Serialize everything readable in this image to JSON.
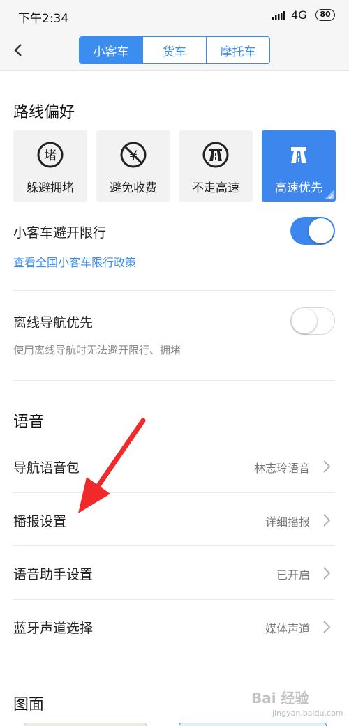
{
  "status": {
    "time": "下午2:34",
    "network": "4G",
    "battery": "80"
  },
  "header": {
    "tabs": [
      {
        "label": "小客车"
      },
      {
        "label": "货车"
      },
      {
        "label": "摩托车"
      }
    ]
  },
  "route": {
    "title": "路线偏好",
    "options": [
      {
        "label": "躲避拥堵",
        "icon": "avoid-congestion-icon"
      },
      {
        "label": "避免收费",
        "icon": "avoid-toll-icon"
      },
      {
        "label": "不走高速",
        "icon": "no-highway-icon"
      },
      {
        "label": "高速优先",
        "icon": "highway-icon"
      }
    ],
    "restriction_label": "小客车避开限行",
    "restriction_link": "查看全国小客车限行政策",
    "offline_label": "离线导航优先",
    "offline_note": "使用离线导航时无法避开限行、拥堵"
  },
  "voice": {
    "title": "语音",
    "items": [
      {
        "label": "导航语音包",
        "value": "林志玲语音"
      },
      {
        "label": "播报设置",
        "value": "详细播报"
      },
      {
        "label": "语音助手设置",
        "value": "已开启"
      },
      {
        "label": "蓝牙声道选择",
        "value": "媒体声道"
      }
    ]
  },
  "display": {
    "title": "图面"
  },
  "watermark": {
    "text": "Bai 经验",
    "sub": "jingyan.baidu.com"
  },
  "colors": {
    "accent": "#3b8ef0",
    "arrow": "#f02a2a"
  }
}
